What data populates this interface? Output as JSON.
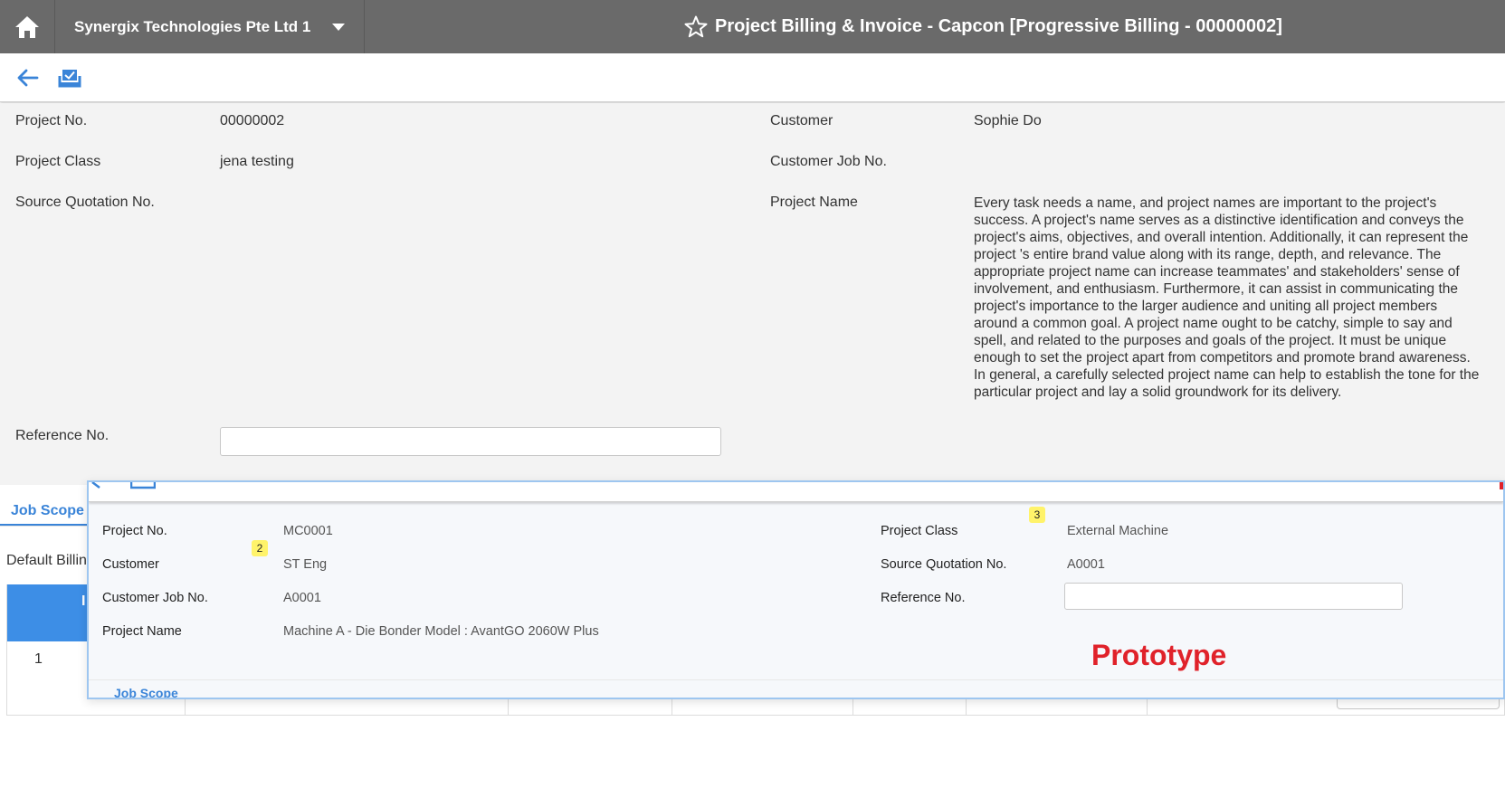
{
  "header": {
    "company": "Synergix Technologies Pte Ltd 1",
    "title": "Project Billing & Invoice - Capcon [Progressive Billing - 00000002]"
  },
  "icons": {
    "home": "home-icon",
    "dropdown": "caret-down-icon",
    "favorite": "star-outline-icon",
    "back": "arrow-left-icon",
    "save": "save-tray-icon"
  },
  "form": {
    "project_no_label": "Project No.",
    "project_no": "00000002",
    "project_class_label": "Project Class",
    "project_class": "jena testing",
    "source_quotation_label": "Source Quotation No.",
    "reference_no_label": "Reference No.",
    "customer_label": "Customer",
    "customer": "Sophie Do",
    "customer_job_label": "Customer Job No.",
    "project_name_label": "Project Name",
    "project_name": "Every task needs a name, and project names are important to the project's success. A project's name serves as a distinctive identification and conveys the project's aims, objectives, and overall intention. Additionally, it can represent the project 's entire brand value along with its range, depth, and relevance. The appropriate project name can increase teammates' and stakeholders' sense of involvement, and enthusiasm. Furthermore, it can assist in communicating the project's importance to the larger audience and uniting all project members around a common goal. A project name ought to be catchy, simple to say and spell, and related to the purposes and goals of the project. It must be unique enough to set the project apart from competitors and promote brand awareness. In general, a carefully selected project name can help to establish the tone for the particular project and lay a solid groundwork for its delivery."
  },
  "background": {
    "tab": "Job Scope",
    "default_billing": "Default Billin",
    "table_head": "I",
    "row_num": "1"
  },
  "overlay": {
    "project_no_label": "Project No.",
    "project_no": "MC0001",
    "customer_label": "Customer",
    "customer": "ST Eng",
    "customer_job_label": "Customer Job No.",
    "customer_job": "A0001",
    "project_name_label": "Project Name",
    "project_name": "Machine A - Die Bonder Model : AvantGO 2060W Plus",
    "project_class_label": "Project Class",
    "project_class": "External Machine",
    "source_quotation_label": "Source Quotation No.",
    "source_quotation": "A0001",
    "reference_no_label": "Reference No.",
    "badge_2": "2",
    "badge_3": "3",
    "prototype": "Prototype",
    "tab": "Job Scope"
  },
  "colors": {
    "topbar": "#6a6a6a",
    "accent": "#3a84d8",
    "table_header": "#3d8ee6",
    "prototype": "#e0222a",
    "badge": "#fff36a"
  }
}
